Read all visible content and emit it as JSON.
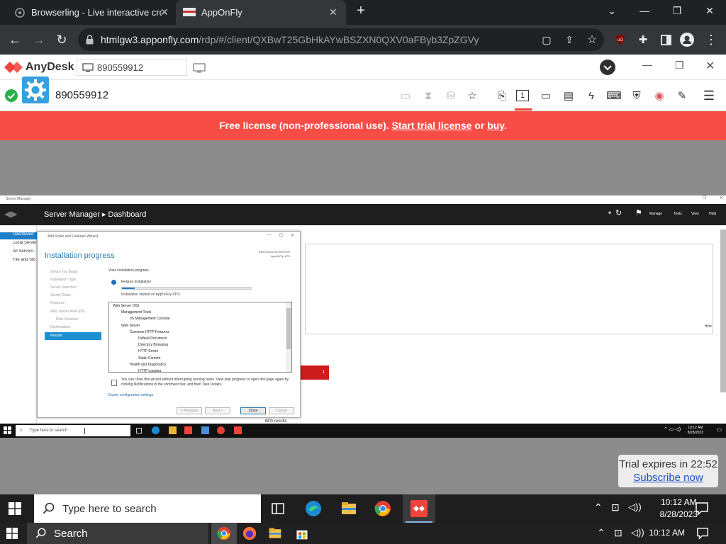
{
  "browser": {
    "tabs": [
      {
        "title": "Browserling - Live interactive cro",
        "close": "✕"
      },
      {
        "title": "AppOnFly",
        "close": "✕"
      }
    ],
    "new_tab": "+",
    "url_host": "htmlgw3.apponfly.com",
    "url_path": "/rdp/#/client/QXBwT25GbHkAYwBSZXN0QXV0aFByb3ZpZGVy",
    "window_controls": [
      "⌄",
      "—",
      "❐",
      "✕"
    ]
  },
  "anydesk": {
    "brand": "AnyDesk",
    "address_value": "890559912",
    "remote_id": "890559912",
    "banner": {
      "prefix": "Free license (non-professional use). ",
      "trial_link": "Start trial license",
      "middle": " or ",
      "buy_link": "buy",
      "suffix": "."
    },
    "colors": {
      "banner": "#f84d46",
      "brand": "#ef443b"
    }
  },
  "remote": {
    "server_manager": {
      "window_title": "Server Manager",
      "breadcrumb": "Server Manager ▸ Dashboard",
      "menus": [
        "Manage",
        "Tools",
        "View",
        "Help"
      ],
      "sidebar": [
        "Dashboard",
        "Local Server",
        "All Servers",
        "File and Sto"
      ],
      "hide": "Hide",
      "tile_count": "1",
      "bpa": "BPA results"
    },
    "wizard": {
      "title": "Add Roles and Features Wizard",
      "heading": "Installation progress",
      "dest_line1": "DESTINATION SERVER",
      "dest_line2": "AppOnFly-VPS",
      "steps": [
        "Before You Begin",
        "Installation Type",
        "Server Selection",
        "Server Roles",
        "Features",
        "Web Server Role (IIS)",
        "Role Services",
        "Confirmation"
      ],
      "active_step": "Results",
      "view_label": "View installation progress",
      "feature_label": "Feature installation",
      "progress": 0.1,
      "started": "Installation started on AppOnFly-VPS",
      "items": [
        {
          "text": "Web Server (IIS)",
          "level": 0
        },
        {
          "text": "Management Tools",
          "level": 1
        },
        {
          "text": "IIS Management Console",
          "level": 2
        },
        {
          "text": "Web Server",
          "level": 1
        },
        {
          "text": "Common HTTP Features",
          "level": 2
        },
        {
          "text": "Default Document",
          "level": 3
        },
        {
          "text": "Directory Browsing",
          "level": 3
        },
        {
          "text": "HTTP Errors",
          "level": 3
        },
        {
          "text": "Static Content",
          "level": 3
        },
        {
          "text": "Health and Diagnostics",
          "level": 2
        },
        {
          "text": "HTTP Logging",
          "level": 3
        }
      ],
      "note": "You can close this wizard without interrupting running tasks. View task progress or open this page again by clicking Notifications in the command bar, and then Task Details.",
      "export": "Export configuration settings",
      "buttons": {
        "previous": "< Previous",
        "next": "Next >",
        "close": "Close",
        "cancel": "Cancel"
      }
    },
    "taskbar": {
      "search": "Type here to search",
      "time": "10:12 AM",
      "date": "8/28/2023"
    }
  },
  "trial": {
    "text": "Trial expires in 22:52",
    "link": "Subscribe now"
  },
  "taskbar_mid": {
    "search": "Type here to search",
    "time": "10:12 AM",
    "date": "8/28/2023"
  },
  "taskbar_bottom": {
    "search": "Search",
    "time": "10:12 AM"
  }
}
